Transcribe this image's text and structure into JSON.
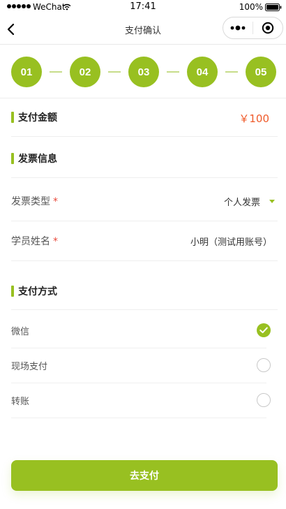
{
  "status_bar": {
    "carrier": "WeChat",
    "time": "17:41",
    "battery": "100%"
  },
  "nav": {
    "title": "支付确认"
  },
  "steps": [
    "01",
    "02",
    "03",
    "04",
    "05"
  ],
  "amount_section": {
    "title": "支付金额",
    "amount": "￥100"
  },
  "invoice_section": {
    "title": "发票信息",
    "fields": [
      {
        "label": "发票类型",
        "required_mark": "*",
        "value": "个人发票"
      },
      {
        "label": "学员姓名",
        "required_mark": "*",
        "value": "小明（测试用账号）"
      }
    ]
  },
  "payment_section": {
    "title": "支付方式",
    "options": [
      {
        "label": "微信",
        "selected": true
      },
      {
        "label": "现场支付",
        "selected": false
      },
      {
        "label": "转账",
        "selected": false
      }
    ]
  },
  "submit_label": "去支付",
  "colors": {
    "accent": "#98c021",
    "amount": "#ef5a2a",
    "required": "#e94a3c"
  }
}
